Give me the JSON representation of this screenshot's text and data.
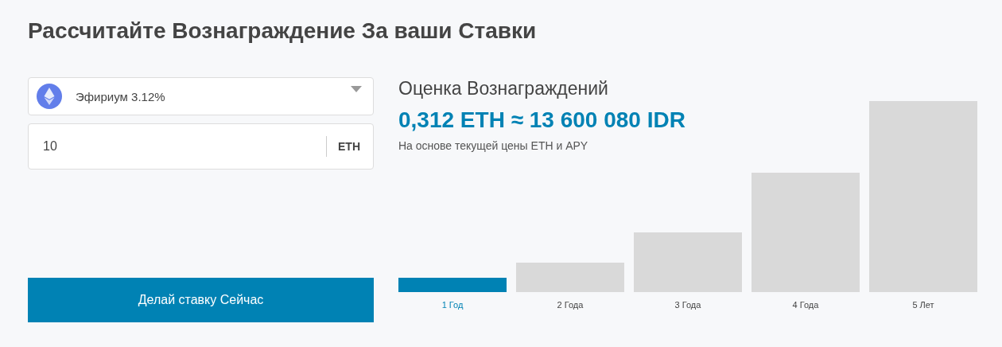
{
  "title": "Рассчитайте Вознаграждение За ваши Ставки",
  "asset_select": {
    "value": "Эфириум 3.12%"
  },
  "amount_field": {
    "value": "10",
    "unit": "ETH"
  },
  "stake_button": "Делай ставку Сейчас",
  "estimate": {
    "heading": "Оценка Вознаграждений",
    "amount": "0,312 ETH ≈ 13 600 080 IDR",
    "note": "На основе текущей цены ETH и APY"
  },
  "periods": [
    {
      "label": "1 Год",
      "selected": true
    },
    {
      "label": "2 Года",
      "selected": false
    },
    {
      "label": "3 Года",
      "selected": false
    },
    {
      "label": "4 Года",
      "selected": false
    },
    {
      "label": "5 Лет",
      "selected": false
    }
  ]
}
